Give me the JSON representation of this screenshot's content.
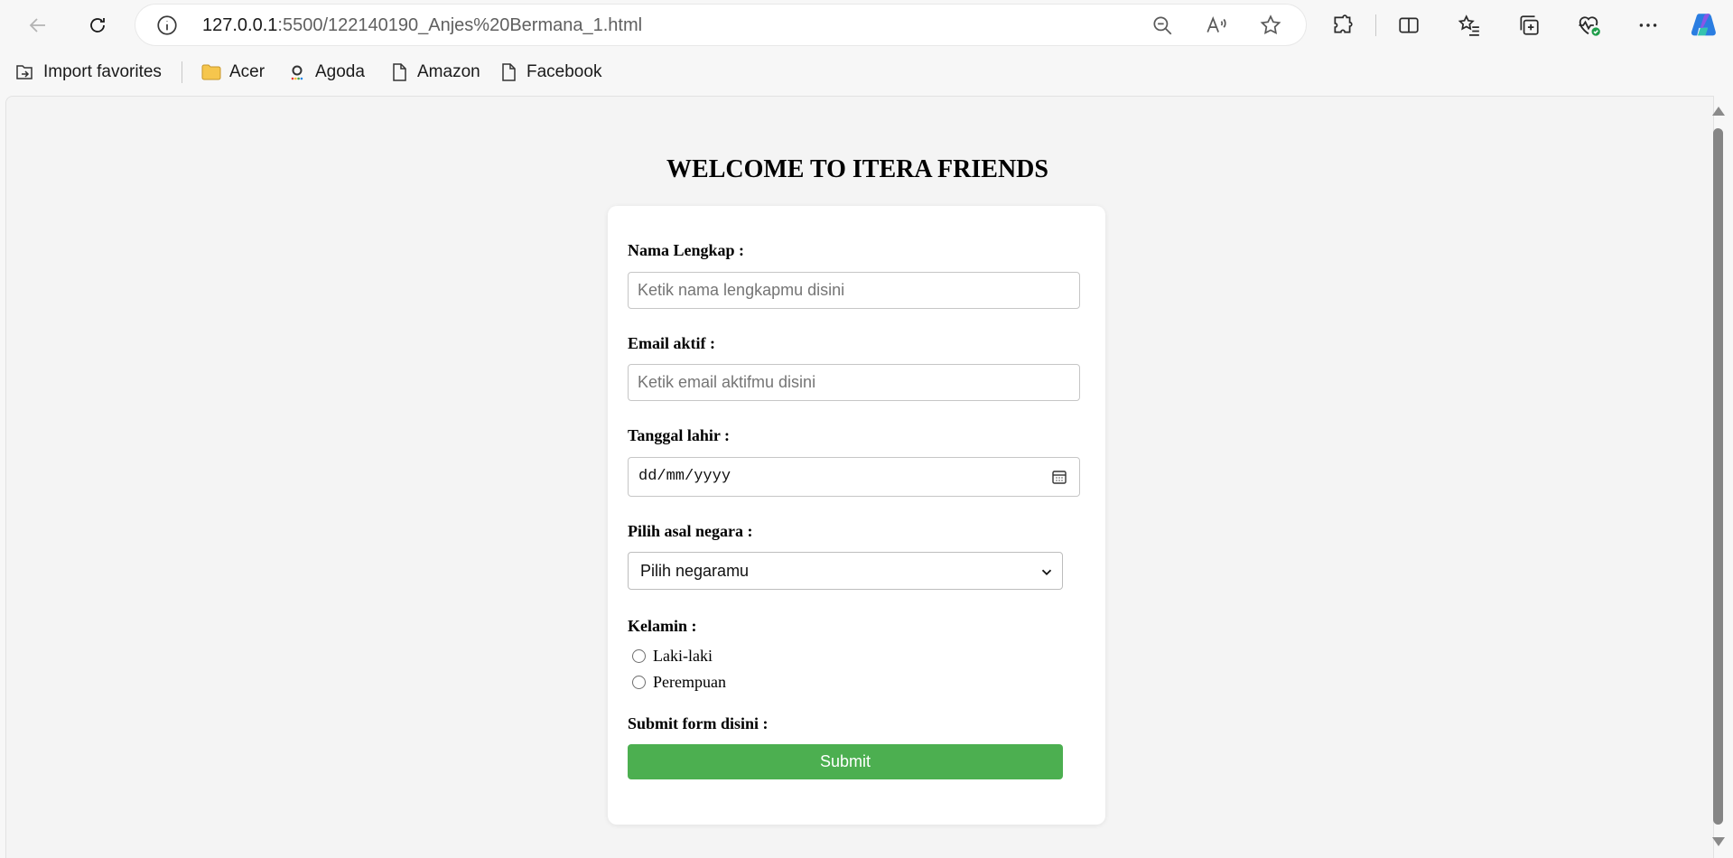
{
  "browser": {
    "url_host": "127.0.0.1",
    "url_rest": ":5500/122140190_Anjes%20Bermana_1.html",
    "bookmarks": [
      {
        "label": "Import favorites",
        "icon": "import-icon"
      },
      {
        "label": "Acer",
        "icon": "folder-icon"
      },
      {
        "label": "Agoda",
        "icon": "agoda-icon"
      },
      {
        "label": "Amazon",
        "icon": "page-icon"
      },
      {
        "label": "Facebook",
        "icon": "page-icon"
      }
    ]
  },
  "page": {
    "title": "WELCOME TO ITERA FRIENDS",
    "form": {
      "name_label": "Nama Lengkap :",
      "name_placeholder": "Ketik nama lengkapmu disini",
      "email_label": "Email aktif :",
      "email_placeholder": "Ketik email aktifmu disini",
      "dob_label": "Tanggal lahir :",
      "dob_format": "dd/mm/yyyy",
      "country_label": "Pilih asal negara :",
      "country_selected": "Pilih negaramu",
      "gender_label": "Kelamin :",
      "gender_options": [
        "Laki-laki",
        "Perempuan"
      ],
      "submit_label": "Submit form disini :",
      "submit_button": "Submit"
    }
  },
  "colors": {
    "submit_bg": "#4caf50",
    "page_bg": "#f4f4f4",
    "card_bg": "#ffffff"
  }
}
